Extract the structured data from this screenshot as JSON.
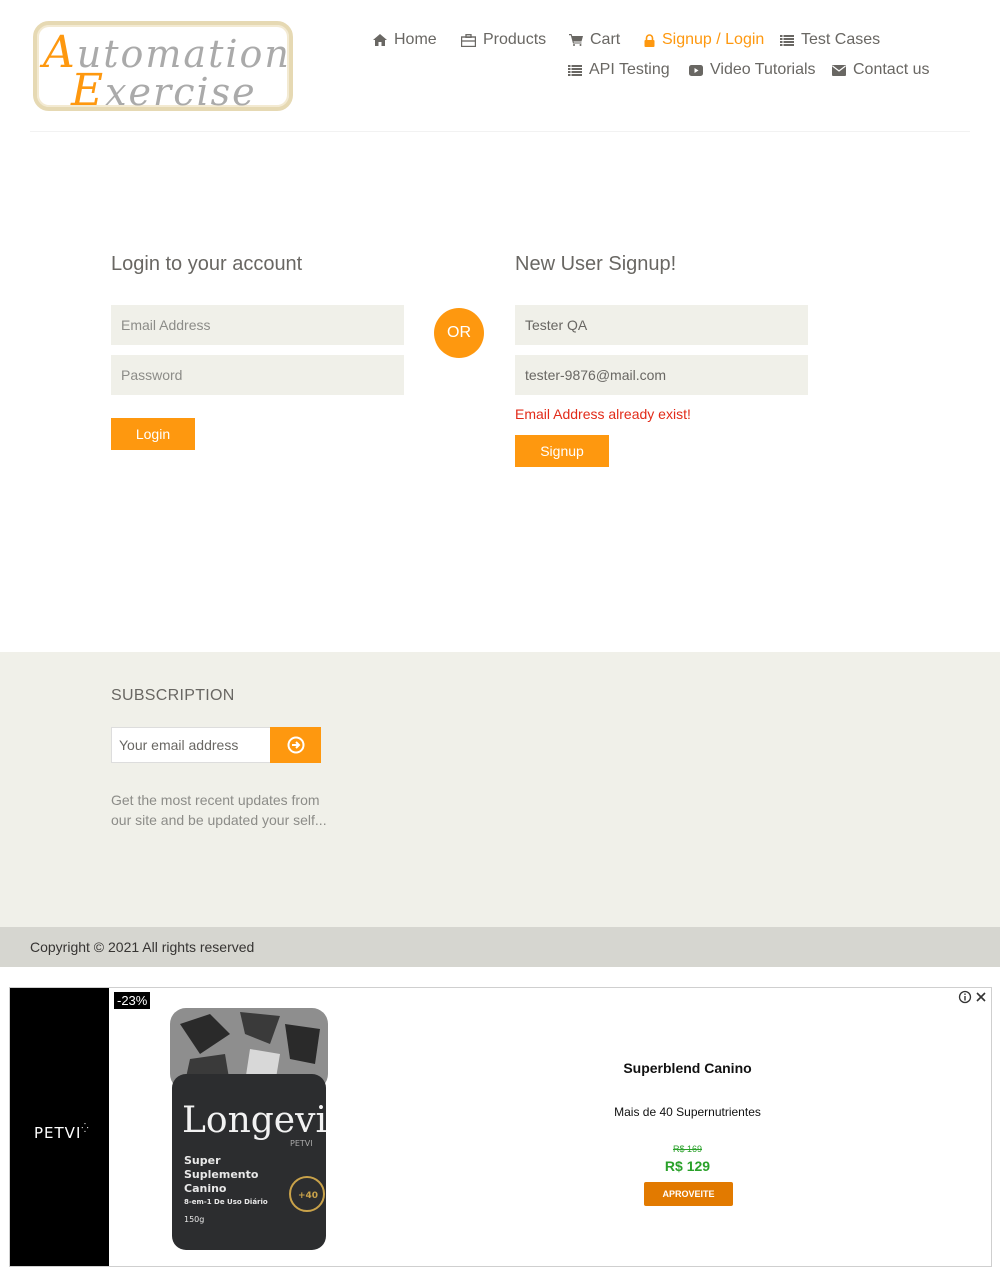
{
  "header": {
    "logo_line1_cap": "A",
    "logo_line1_rest": "utomation",
    "logo_line2_cap": "E",
    "logo_line2_rest": "xercise",
    "nav": {
      "home": "Home",
      "products": "Products",
      "cart": "Cart",
      "signup_login": "Signup / Login",
      "test_cases": "Test Cases",
      "api_testing": "API Testing",
      "video_tutorials": "Video Tutorials",
      "contact_us": "Contact us"
    },
    "active_nav": "signup_login"
  },
  "login": {
    "title": "Login to your account",
    "email_placeholder": "Email Address",
    "password_placeholder": "Password",
    "button": "Login"
  },
  "or_label": "OR",
  "signup": {
    "title": "New User Signup!",
    "name_value": "Tester QA",
    "email_value": "tester-9876@mail.com",
    "error": "Email Address already exist!",
    "button": "Signup"
  },
  "subscription": {
    "title": "SUBSCRIPTION",
    "email_placeholder": "Your email address",
    "description": "Get the most recent updates from our site and be updated your self..."
  },
  "footer": {
    "copyright": "Copyright © 2021 All rights reserved"
  },
  "ad": {
    "brand": "PETVI",
    "discount": "-23%",
    "product_name_on_jar": "Longevi",
    "jar_brand": "PETVI",
    "jar_line1": "Super",
    "jar_line2": "Suplemento",
    "jar_line3": "Canino",
    "jar_line4": "8-em-1 De Uso Diário",
    "jar_weight": "150g",
    "jar_badge": "+40",
    "title": "Superblend Canino",
    "subtitle": "Mais de 40 Supernutrientes",
    "old_price": "R$ 169",
    "price": "R$ 129",
    "cta": "APROVEITE"
  },
  "colors": {
    "accent": "#fe980f",
    "input_bg": "#f0f0e9",
    "error": "#e22b19",
    "footer_bg": "#f0f0e9",
    "footer_bottom_bg": "#d6d6d0",
    "ad_price_green": "#2aa12a",
    "ad_cta": "#e27a00"
  }
}
